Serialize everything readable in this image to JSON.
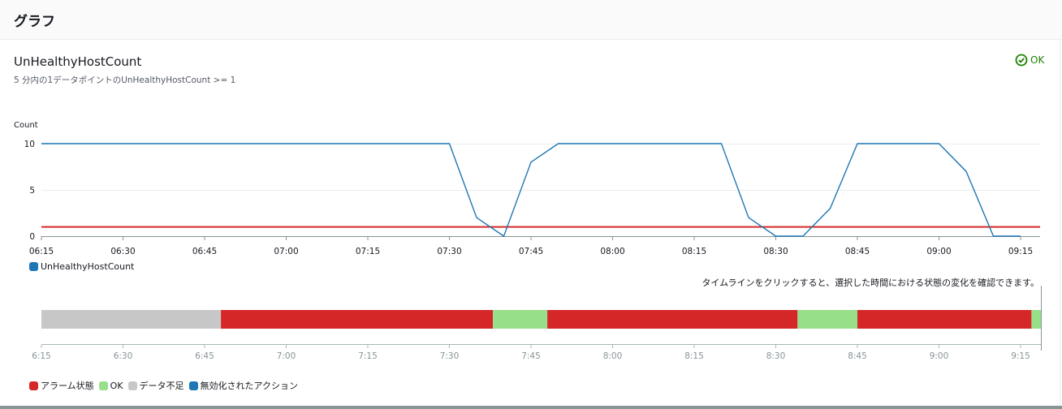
{
  "panel": {
    "title": "グラフ"
  },
  "metric": {
    "title": "UnHealthyHostCount",
    "description": "5 分内の1データポイントのUnHealthyHostCount >= 1"
  },
  "status": {
    "label": "OK",
    "color": "#1d8102",
    "icon": "check-circle-icon"
  },
  "timeline_hint": "タイムラインをクリックすると、選択した時間における状態の変化を確認できます。",
  "colors": {
    "series": "#1f77b4",
    "threshold": "#d62728",
    "alarm": "#d62728",
    "ok": "#98df8a",
    "insufficient": "#c7c7c7",
    "action_disabled": "#1f77b4"
  },
  "chart_data": [
    {
      "type": "line",
      "ylabel": "Count",
      "yticks": [
        "0",
        "5",
        "10"
      ],
      "ylim": [
        0,
        10
      ],
      "grid": true,
      "xticks": [
        "06:15",
        "06:30",
        "06:45",
        "07:00",
        "07:15",
        "07:30",
        "07:45",
        "08:00",
        "08:15",
        "08:30",
        "08:45",
        "09:00",
        "09:15"
      ],
      "threshold": 1,
      "series": [
        {
          "name": "UnHealthyHostCount",
          "color": "#1f77b4",
          "x": [
            "06:15",
            "06:20",
            "06:25",
            "06:30",
            "06:35",
            "06:40",
            "06:45",
            "06:50",
            "06:55",
            "07:00",
            "07:05",
            "07:10",
            "07:15",
            "07:20",
            "07:25",
            "07:30",
            "07:35",
            "07:40",
            "07:45",
            "07:50",
            "07:55",
            "08:00",
            "08:05",
            "08:10",
            "08:15",
            "08:20",
            "08:25",
            "08:30",
            "08:35",
            "08:40",
            "08:45",
            "08:50",
            "08:55",
            "09:00",
            "09:05",
            "09:10",
            "09:15"
          ],
          "values": [
            10,
            10,
            10,
            10,
            10,
            10,
            10,
            10,
            10,
            10,
            10,
            10,
            10,
            10,
            10,
            10,
            2,
            0,
            8,
            10,
            10,
            10,
            10,
            10,
            10,
            10,
            2,
            0,
            0,
            3,
            10,
            10,
            10,
            10,
            7,
            0,
            0
          ]
        }
      ],
      "legend": [
        "UnHealthyHostCount"
      ],
      "legend_position": "bottom-left"
    },
    {
      "type": "timeline",
      "xticks": [
        "6:15",
        "6:30",
        "6:45",
        "7:00",
        "7:15",
        "7:30",
        "7:45",
        "8:00",
        "8:15",
        "8:30",
        "8:45",
        "9:00",
        "9:15"
      ],
      "segments": [
        {
          "state": "insufficient",
          "start": "06:15",
          "end": "06:48"
        },
        {
          "state": "alarm",
          "start": "06:48",
          "end": "07:38"
        },
        {
          "state": "ok",
          "start": "07:38",
          "end": "07:48"
        },
        {
          "state": "alarm",
          "start": "07:48",
          "end": "08:34"
        },
        {
          "state": "ok",
          "start": "08:34",
          "end": "08:45"
        },
        {
          "state": "alarm",
          "start": "08:45",
          "end": "09:17"
        },
        {
          "state": "ok",
          "start": "09:17",
          "end": "09:19"
        }
      ],
      "legend": [
        {
          "label": "アラーム状態",
          "state": "alarm"
        },
        {
          "label": "OK",
          "state": "ok"
        },
        {
          "label": "データ不足",
          "state": "insufficient"
        },
        {
          "label": "無効化されたアクション",
          "state": "action_disabled"
        }
      ],
      "legend_position": "bottom-left"
    }
  ]
}
